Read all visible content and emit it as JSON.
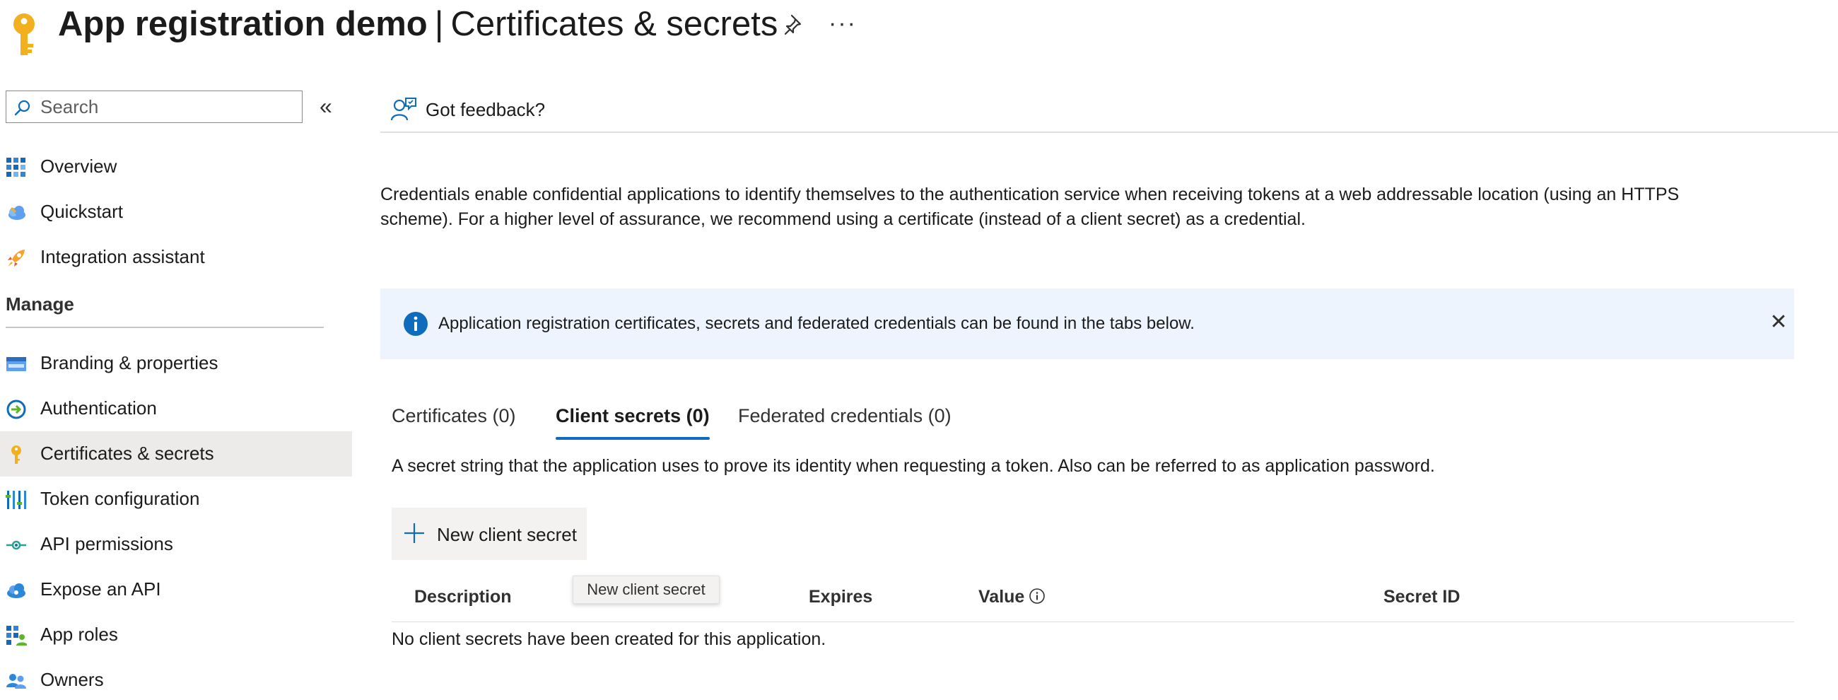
{
  "header": {
    "title_bold": "App registration demo",
    "title_sep": "|",
    "title_rest": "Certificates & secrets",
    "more": "···"
  },
  "sidebar": {
    "search": {
      "placeholder": "Search",
      "value": ""
    },
    "collapse_glyph": "«",
    "items": [
      {
        "label": "Overview",
        "icon": "overview-grid-icon"
      },
      {
        "label": "Quickstart",
        "icon": "cloud-quickstart-icon"
      },
      {
        "label": "Integration assistant",
        "icon": "rocket-icon"
      }
    ],
    "manage_header": "Manage",
    "manage_items": [
      {
        "label": "Branding & properties",
        "icon": "branding-icon"
      },
      {
        "label": "Authentication",
        "icon": "authentication-icon"
      },
      {
        "label": "Certificates & secrets",
        "icon": "key-icon",
        "selected": true
      },
      {
        "label": "Token configuration",
        "icon": "token-bars-icon"
      },
      {
        "label": "API permissions",
        "icon": "api-permissions-icon"
      },
      {
        "label": "Expose an API",
        "icon": "cloud-expose-icon"
      },
      {
        "label": "App roles",
        "icon": "app-roles-icon"
      },
      {
        "label": "Owners",
        "icon": "owners-icon"
      }
    ]
  },
  "main": {
    "feedback_label": "Got feedback?",
    "description": "Credentials enable confidential applications to identify themselves to the authentication service when receiving tokens at a web addressable location (using an HTTPS scheme). For a higher level of assurance, we recommend using a certificate (instead of a client secret) as a credential.",
    "info_bar": {
      "text": "Application registration certificates, secrets and federated credentials can be found in the tabs below.",
      "close_glyph": "✕"
    },
    "tabs": [
      {
        "label": "Certificates (0)",
        "active": false
      },
      {
        "label": "Client secrets (0)",
        "active": true
      },
      {
        "label": "Federated credentials (0)",
        "active": false
      }
    ],
    "secret_description": "A secret string that the application uses to prove its identity when requesting a token. Also can be referred to as application password.",
    "new_secret_button": "New client secret",
    "tooltip": "New client secret",
    "table": {
      "columns": [
        "Description",
        "Expires",
        "Value",
        "Secret ID"
      ],
      "empty_message": "No client secrets have been created for this application."
    }
  },
  "colors": {
    "accent": "#0f6cbd",
    "info_bar_bg": "#eef4fd",
    "selected_bg": "#edebe9",
    "key_yellow": "#f2b01e"
  }
}
